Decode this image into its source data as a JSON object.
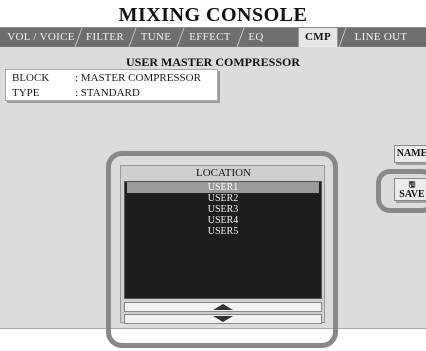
{
  "app": {
    "title": "MIXING CONSOLE"
  },
  "tabs": [
    {
      "label": "VOL / VOICE",
      "active": false
    },
    {
      "label": "FILTER",
      "active": false
    },
    {
      "label": "TUNE",
      "active": false
    },
    {
      "label": "EFFECT",
      "active": false
    },
    {
      "label": "EQ",
      "active": false
    },
    {
      "label": "CMP",
      "active": true
    },
    {
      "label": "LINE OUT",
      "active": false
    }
  ],
  "page": {
    "title": "USER MASTER COMPRESSOR",
    "info": [
      {
        "key": "BLOCK",
        "value": ": MASTER COMPRESSOR"
      },
      {
        "key": "TYPE",
        "value": ": STANDARD"
      }
    ]
  },
  "location": {
    "label": "LOCATION",
    "items": [
      "USER1",
      "USER2",
      "USER3",
      "USER4",
      "USER5"
    ],
    "selected": "USER1"
  },
  "buttons": {
    "name": "NAME",
    "save": "SAVE",
    "save_icon": "floppy-disk-icon"
  },
  "colors": {
    "tab_bar": "#6e6e6e",
    "content_bg": "#dcdcdc",
    "list_bg": "#1d1d1d",
    "highlight_ring": "#888888"
  }
}
